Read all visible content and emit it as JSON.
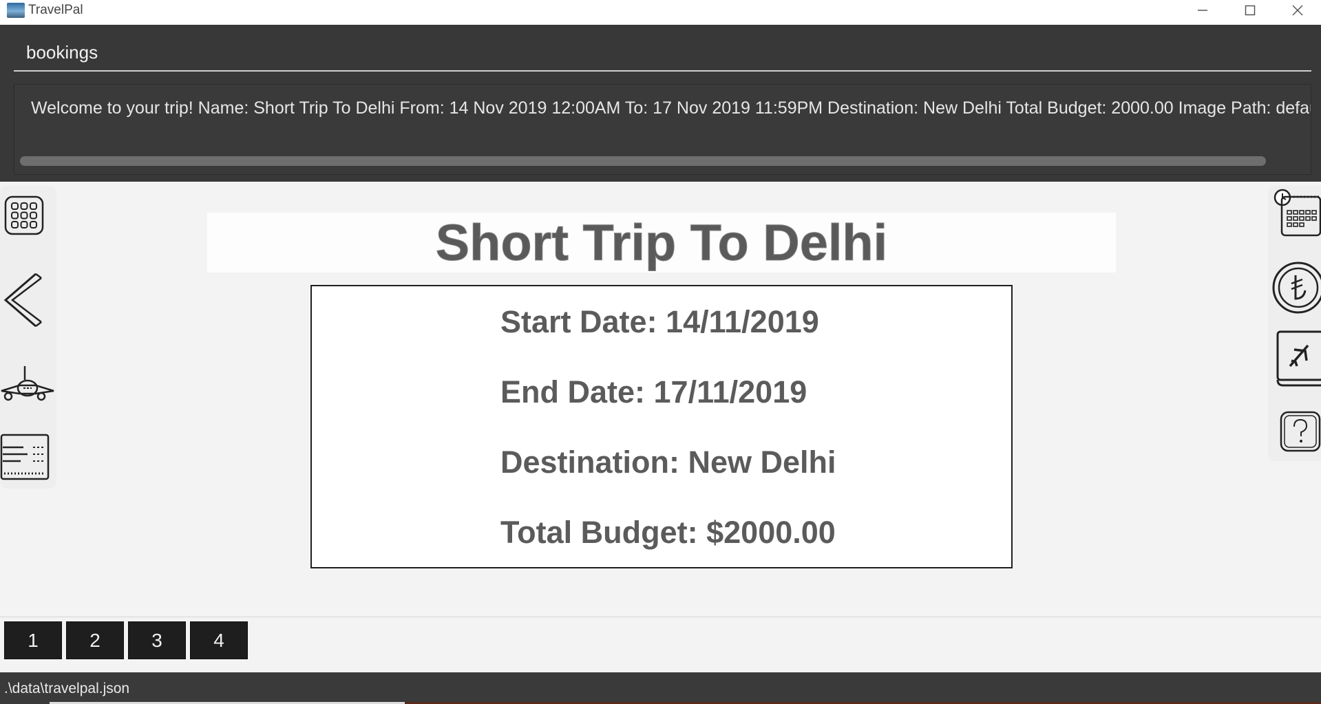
{
  "window": {
    "title": "TravelPal",
    "controls": [
      "minimize",
      "maximize",
      "close"
    ]
  },
  "command_box": {
    "value": "bookings"
  },
  "result_display": {
    "text": "Welcome to your trip! Name: Short Trip To Delhi From: 14 Nov 2019 12:00AM To: 17 Nov 2019 11:59PM Destination: New Delhi Total Budget: 2000.00 Image Path: default im"
  },
  "left_nav": [
    {
      "icon": "grid-menu-icon"
    },
    {
      "icon": "back-arrow-icon"
    },
    {
      "icon": "airplane-icon"
    },
    {
      "icon": "ticket-icon"
    }
  ],
  "right_nav": [
    {
      "icon": "calendar-clock-icon"
    },
    {
      "icon": "currency-coin-icon"
    },
    {
      "icon": "flight-booking-icon"
    },
    {
      "icon": "help-icon"
    }
  ],
  "trip": {
    "name": "Short Trip To Delhi",
    "start_date": "Start Date: 14/11/2019",
    "end_date": "End Date: 17/11/2019",
    "destination": "Destination: New Delhi",
    "total_budget": "Total Budget: $2000.00"
  },
  "pages": [
    "1",
    "2",
    "3",
    "4"
  ],
  "status": {
    "path": ".\\data\\travelpal.json"
  },
  "colors": {
    "dark_panel": "#383838",
    "accent_text": "#5a5a5a",
    "page_button": "#1e1e1e"
  }
}
